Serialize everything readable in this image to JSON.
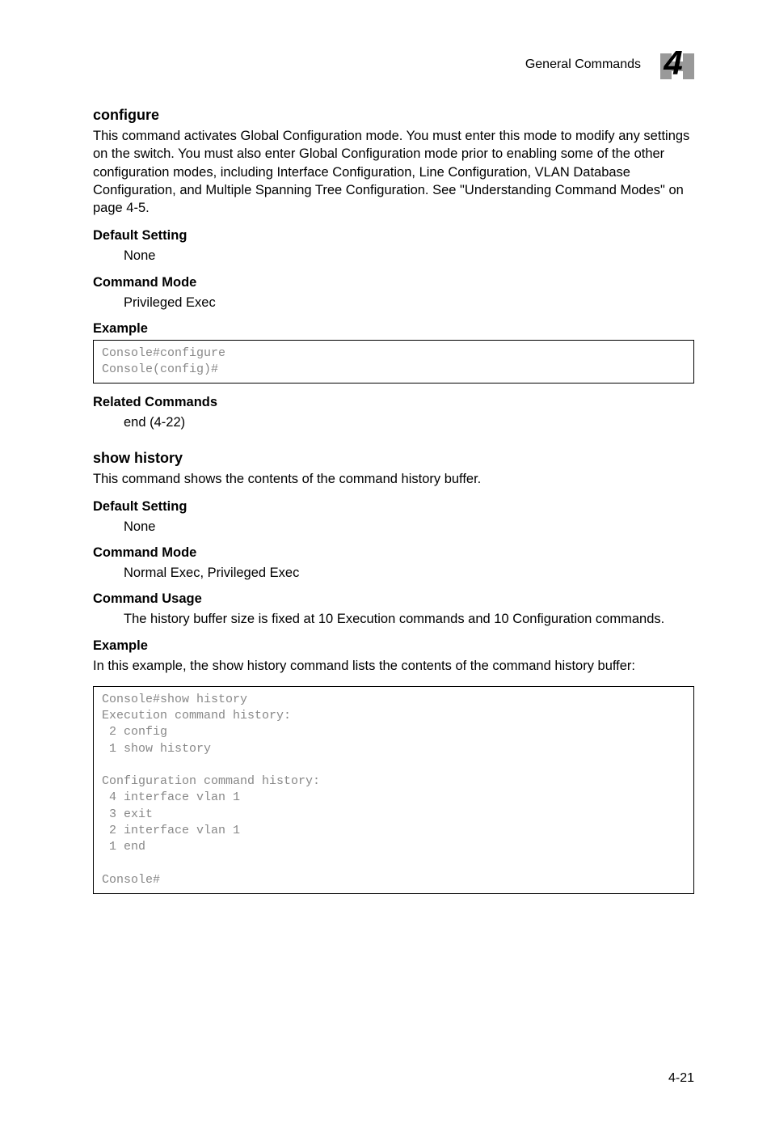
{
  "header": {
    "section_title": "General Commands",
    "chapter_number": "4"
  },
  "configure": {
    "heading": "configure",
    "description": "This command activates Global Configuration mode. You must enter this mode to modify any settings on the switch. You must also enter Global Configuration mode prior to enabling some of the other configuration modes, including Interface Configuration, Line Configuration, VLAN Database Configuration, and Multiple Spanning Tree Configuration. See \"Understanding Command Modes\" on page 4-5.",
    "default_setting_label": "Default Setting",
    "default_setting_value": "None",
    "command_mode_label": "Command Mode",
    "command_mode_value": "Privileged Exec",
    "example_label": "Example",
    "example_code": "Console#configure\nConsole(config)#",
    "related_commands_label": "Related Commands",
    "related_commands_value": "end (4-22)"
  },
  "show_history": {
    "heading": "show history",
    "description": "This command shows the contents of the command history buffer.",
    "default_setting_label": "Default Setting",
    "default_setting_value": "None",
    "command_mode_label": "Command Mode",
    "command_mode_value": "Normal Exec, Privileged Exec",
    "command_usage_label": "Command Usage",
    "command_usage_value": "The history buffer size is fixed at 10 Execution commands and 10 Configuration commands.",
    "example_label": "Example",
    "example_intro": "In this example, the show history command lists the contents of the command history buffer:",
    "example_code": "Console#show history\nExecution command history:\n 2 config\n 1 show history\n\nConfiguration command history:\n 4 interface vlan 1\n 3 exit\n 2 interface vlan 1\n 1 end\n\nConsole#"
  },
  "footer": {
    "page_number": "4-21"
  }
}
